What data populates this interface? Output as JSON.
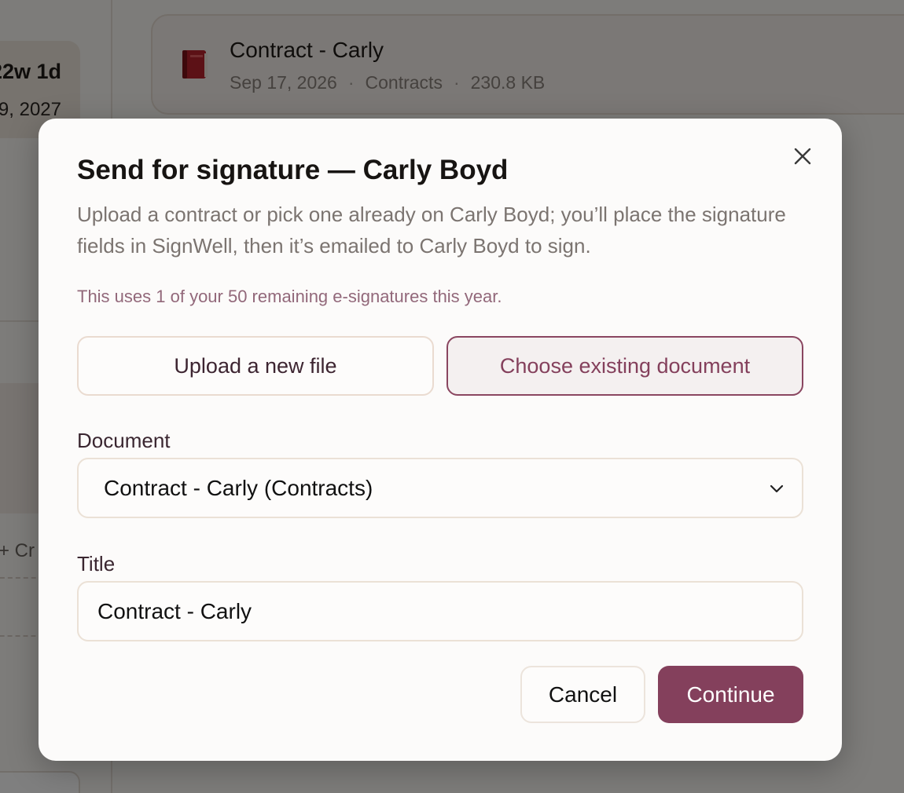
{
  "background": {
    "age_card": {
      "value": "22w 1d",
      "date": "9, 2027"
    },
    "create_link": "+ Cr",
    "document_card": {
      "title": "Contract - Carly",
      "date": "Sep 17, 2026",
      "category": "Contracts",
      "size": "230.8 KB",
      "separator": "·",
      "icon": "red-book-icon"
    }
  },
  "modal": {
    "title": "Send for signature — Carly Boyd",
    "description": "Upload a contract or pick one already on Carly Boyd; you’ll place the signature fields in SignWell, then it’s emailed to Carly Boyd to sign.",
    "quota_note": "This uses 1 of your 50 remaining e-signatures this year.",
    "close_icon": "close-icon",
    "source_options": {
      "upload_label": "Upload a new file",
      "existing_label": "Choose existing document",
      "selected": "existing"
    },
    "document_field": {
      "label": "Document",
      "selected_value": "Contract - Carly (Contracts)"
    },
    "title_field": {
      "label": "Title",
      "value": "Contract - Carly"
    },
    "actions": {
      "cancel_label": "Cancel",
      "continue_label": "Continue"
    }
  },
  "colors": {
    "accent": "#84405c",
    "overlay": "rgba(0,0,0,0.5)"
  }
}
